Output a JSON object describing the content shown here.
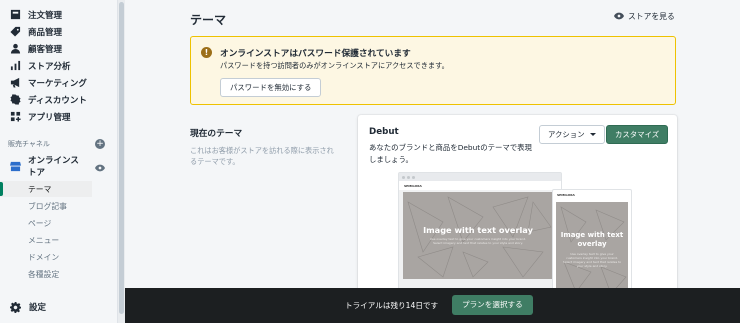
{
  "sidebar": {
    "items": [
      {
        "label": "注文管理",
        "icon": "orders-icon"
      },
      {
        "label": "商品管理",
        "icon": "tag-icon"
      },
      {
        "label": "顧客管理",
        "icon": "person-icon"
      },
      {
        "label": "ストア分析",
        "icon": "bar-chart-icon"
      },
      {
        "label": "マーケティング",
        "icon": "megaphone-icon"
      },
      {
        "label": "ディスカウント",
        "icon": "discount-icon"
      },
      {
        "label": "アプリ管理",
        "icon": "apps-icon"
      }
    ],
    "section_label": "販売チャネル",
    "online_store_label": "オンラインストア",
    "sub_items": [
      "テーマ",
      "ブログ記事",
      "ページ",
      "メニュー",
      "ドメイン",
      "各種設定"
    ],
    "active_sub_item": "テーマ",
    "settings_label": "設定"
  },
  "header": {
    "title": "テーマ",
    "view_store_label": "ストアを見る"
  },
  "banner": {
    "title": "オンラインストアはパスワード保護されています",
    "description": "パスワードを持つ訪問者のみがオンラインストアにアクセスできます。",
    "button_label": "パスワードを無効にする"
  },
  "current_theme": {
    "section_title": "現在のテーマ",
    "section_description": "これはお客様がストアを訪れる際に表示されるテーマです。",
    "theme_name": "Debut",
    "theme_description": "あなたのブランドと商品をDebutのテーマで表現しましょう。",
    "actions_label": "アクション",
    "customize_label": "カスタマイズ",
    "preview": {
      "store_name": "SEMIGURA",
      "hero_heading": "Image with text overlay",
      "hero_text": "Use overlay text to give your customers insight into your brand. Select imagery and text that relates to your style and story."
    }
  },
  "trial_bar": {
    "text": "トライアルは残り14日です",
    "button_label": "プランを選択する"
  },
  "colors": {
    "accent_green": "#3f7d64",
    "banner_bg": "#fdf7e3",
    "banner_border": "#eec200",
    "trial_bar_bg": "#1c1f21"
  }
}
